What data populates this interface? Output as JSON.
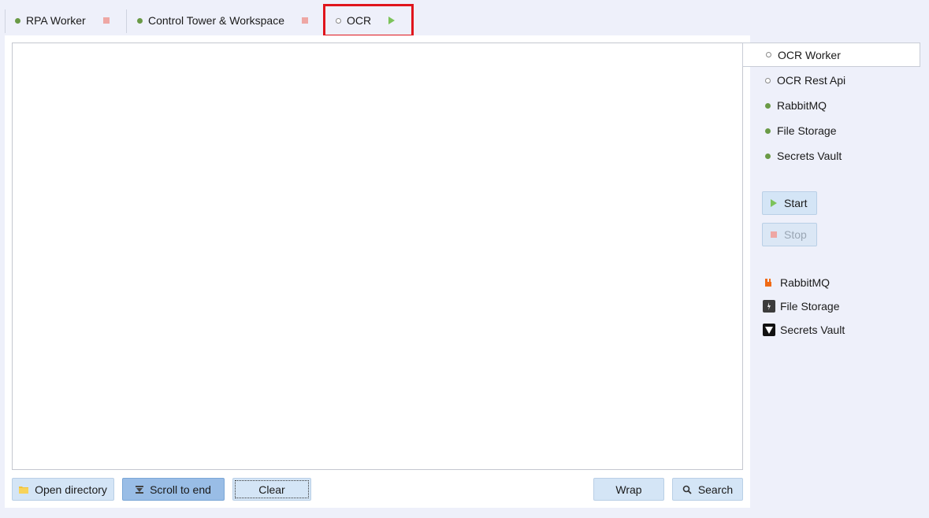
{
  "tabs": [
    {
      "label": "RPA Worker",
      "status_icon": "running-dot-icon",
      "action_icon": "stop-icon"
    },
    {
      "label": "Control Tower & Workspace",
      "status_icon": "running-dot-icon",
      "action_icon": "stop-icon"
    },
    {
      "label": "OCR",
      "status_icon": "stopped-dot-icon",
      "action_icon": "play-icon"
    }
  ],
  "services": [
    {
      "label": "OCR Worker",
      "status": "stopped",
      "selected": true
    },
    {
      "label": "OCR Rest Api",
      "status": "stopped"
    },
    {
      "label": "RabbitMQ",
      "status": "running"
    },
    {
      "label": "File Storage",
      "status": "running"
    },
    {
      "label": "Secrets Vault",
      "status": "running"
    }
  ],
  "controls": {
    "start_label": "Start",
    "stop_label": "Stop"
  },
  "links": [
    {
      "label": "RabbitMQ",
      "icon": "rabbitmq-icon"
    },
    {
      "label": "File Storage",
      "icon": "file-storage-icon"
    },
    {
      "label": "Secrets Vault",
      "icon": "vault-icon"
    }
  ],
  "toolbar": {
    "open_directory": "Open directory",
    "scroll_to_end": "Scroll to end",
    "clear": "Clear",
    "wrap": "Wrap",
    "search": "Search"
  },
  "colors": {
    "running": "#6a9a46",
    "stop": "#eea7a4",
    "play": "#7cc35a",
    "highlight": "#e0151c"
  }
}
